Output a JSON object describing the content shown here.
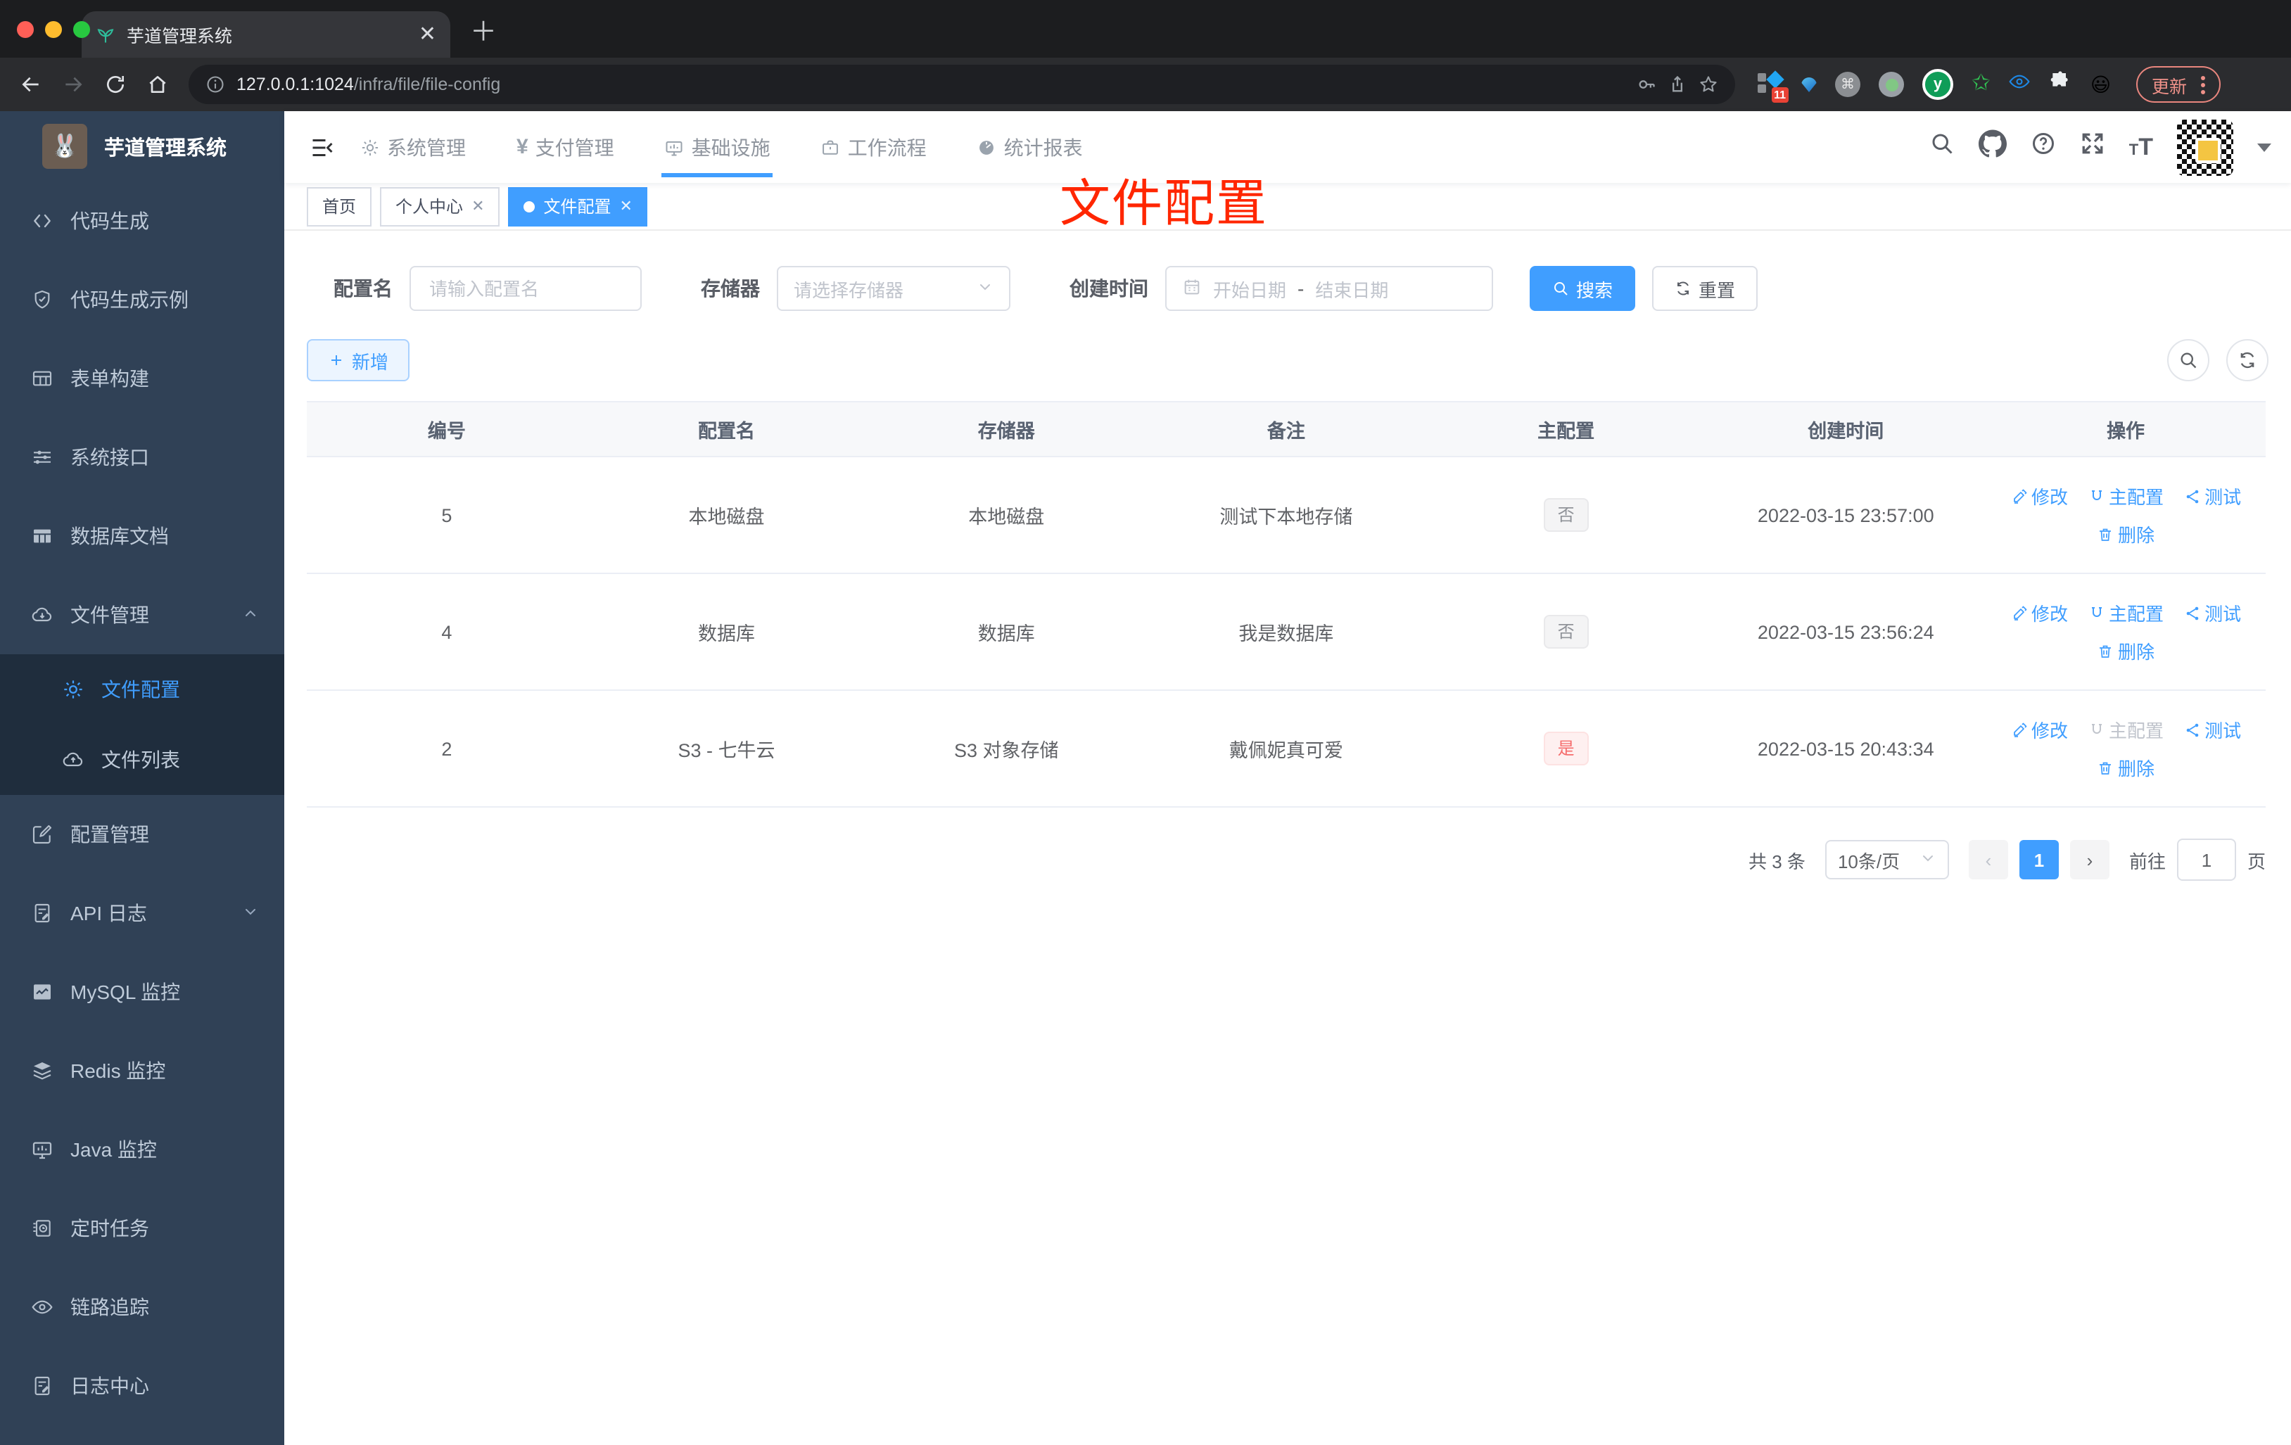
{
  "browser": {
    "tab_title": "芋道管理系统",
    "url_host": "127.0.0.1:1024",
    "url_path": "/infra/file/file-config",
    "ext_badge": "11",
    "update_label": "更新"
  },
  "sidebar": {
    "title": "芋道管理系统",
    "items": [
      {
        "label": "代码生成",
        "icon": "code-icon"
      },
      {
        "label": "代码生成示例",
        "icon": "shield-icon"
      },
      {
        "label": "表单构建",
        "icon": "form-icon"
      },
      {
        "label": "系统接口",
        "icon": "sliders-icon"
      },
      {
        "label": "数据库文档",
        "icon": "grid-icon"
      },
      {
        "label": "文件管理",
        "icon": "cloud-download-icon",
        "expanded": true,
        "children": [
          {
            "label": "文件配置",
            "icon": "gear-icon",
            "active": true
          },
          {
            "label": "文件列表",
            "icon": "cloud-upload-icon"
          }
        ]
      },
      {
        "label": "配置管理",
        "icon": "edit-square-icon"
      },
      {
        "label": "API 日志",
        "icon": "doc-edit-icon",
        "collapsed": true
      },
      {
        "label": "MySQL 监控",
        "icon": "chart-icon"
      },
      {
        "label": "Redis 监控",
        "icon": "layers-icon"
      },
      {
        "label": "Java 监控",
        "icon": "monitor-icon"
      },
      {
        "label": "定时任务",
        "icon": "timer-icon"
      },
      {
        "label": "链路追踪",
        "icon": "eye-icon"
      },
      {
        "label": "日志中心",
        "icon": "log-edit-icon"
      }
    ]
  },
  "topnav": {
    "items": [
      {
        "label": "系统管理",
        "icon": "gear-icon"
      },
      {
        "label": "支付管理",
        "icon": "yen-icon"
      },
      {
        "label": "基础设施",
        "icon": "monitor-icon",
        "active": true
      },
      {
        "label": "工作流程",
        "icon": "briefcase-icon"
      },
      {
        "label": "统计报表",
        "icon": "dashboard-icon"
      }
    ]
  },
  "tags": [
    {
      "label": "首页"
    },
    {
      "label": "个人中心",
      "closable": true
    },
    {
      "label": "文件配置",
      "closable": true,
      "active": true
    }
  ],
  "annotation": {
    "title": "文件配置"
  },
  "filters": {
    "name_label": "配置名",
    "name_placeholder": "请输入配置名",
    "storage_label": "存储器",
    "storage_placeholder": "请选择存储器",
    "time_label": "创建时间",
    "start_placeholder": "开始日期",
    "range_separator": "-",
    "end_placeholder": "结束日期",
    "search_label": "搜索",
    "reset_label": "重置"
  },
  "toolbar": {
    "add_label": "新增"
  },
  "table": {
    "columns": [
      "编号",
      "配置名",
      "存储器",
      "备注",
      "主配置",
      "创建时间",
      "操作"
    ],
    "actions": {
      "edit": "修改",
      "primary": "主配置",
      "test": "测试",
      "remove": "删除"
    },
    "rows": [
      {
        "id": "5",
        "name": "本地磁盘",
        "storage": "本地磁盘",
        "remark": "测试下本地存储",
        "primary": "否",
        "primary_type": "info",
        "created": "2022-03-15 23:57:00",
        "primary_action_disabled": false
      },
      {
        "id": "4",
        "name": "数据库",
        "storage": "数据库",
        "remark": "我是数据库",
        "primary": "否",
        "primary_type": "info",
        "created": "2022-03-15 23:56:24",
        "primary_action_disabled": false
      },
      {
        "id": "2",
        "name": "S3 - 七牛云",
        "storage": "S3 对象存储",
        "remark": "戴佩妮真可爱",
        "primary": "是",
        "primary_type": "danger",
        "created": "2022-03-15 20:43:34",
        "primary_action_disabled": true
      }
    ]
  },
  "pagination": {
    "total": "共 3 条",
    "size": "10条/页",
    "page": "1",
    "goto_label": "前往",
    "goto_value": "1",
    "unit_label": "页"
  }
}
